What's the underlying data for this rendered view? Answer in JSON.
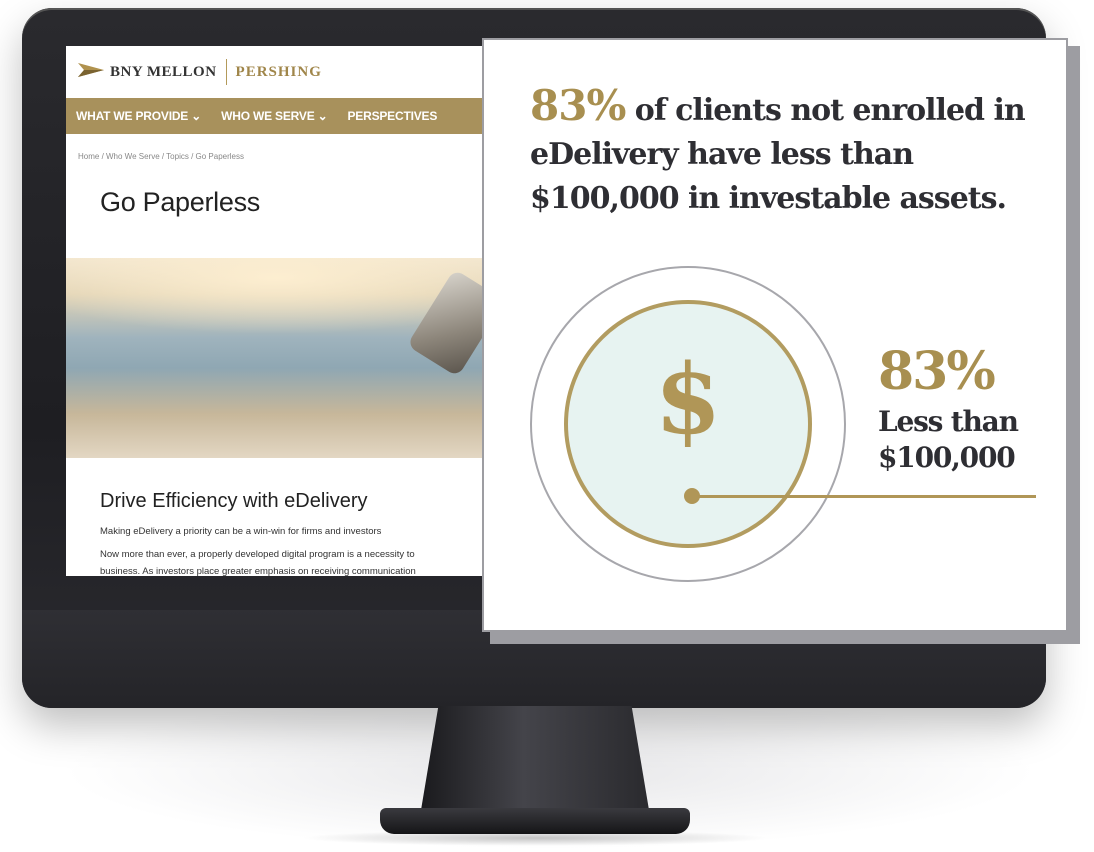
{
  "site": {
    "logo": {
      "brand": "BNY MELLON",
      "sub_brand": "PERSHING"
    },
    "nav": [
      {
        "label": "WHAT WE PROVIDE ⌄"
      },
      {
        "label": "WHO WE SERVE ⌄"
      },
      {
        "label": "PERSPECTIVES"
      }
    ],
    "breadcrumb": "Home  /  Who We Serve  /  Topics  /  Go Paperless",
    "page_title": "Go Paperless",
    "section": {
      "title": "Drive Efficiency with eDelivery",
      "subtitle": "Making eDelivery a priority can be a win-win for firms and investors",
      "body": "Now more than ever, a properly developed digital program is a necessity to",
      "body_2": "business. As investors place greater emphasis on receiving communication"
    }
  },
  "card": {
    "headline_pct": "83%",
    "headline_rest": " of clients not enrolled in eDelivery have less than $100,000 in investable assets.",
    "icon_symbol": "$",
    "stat_value": "83%",
    "stat_label": "Less than $100,000"
  },
  "colors": {
    "gold": "#a88f50",
    "nav_bg": "#a8915c",
    "circle_fill": "#e7f3f1",
    "text_dark": "#2e2e33"
  },
  "icons": [
    "bny-mellon-logo-icon",
    "dollar-icon"
  ]
}
